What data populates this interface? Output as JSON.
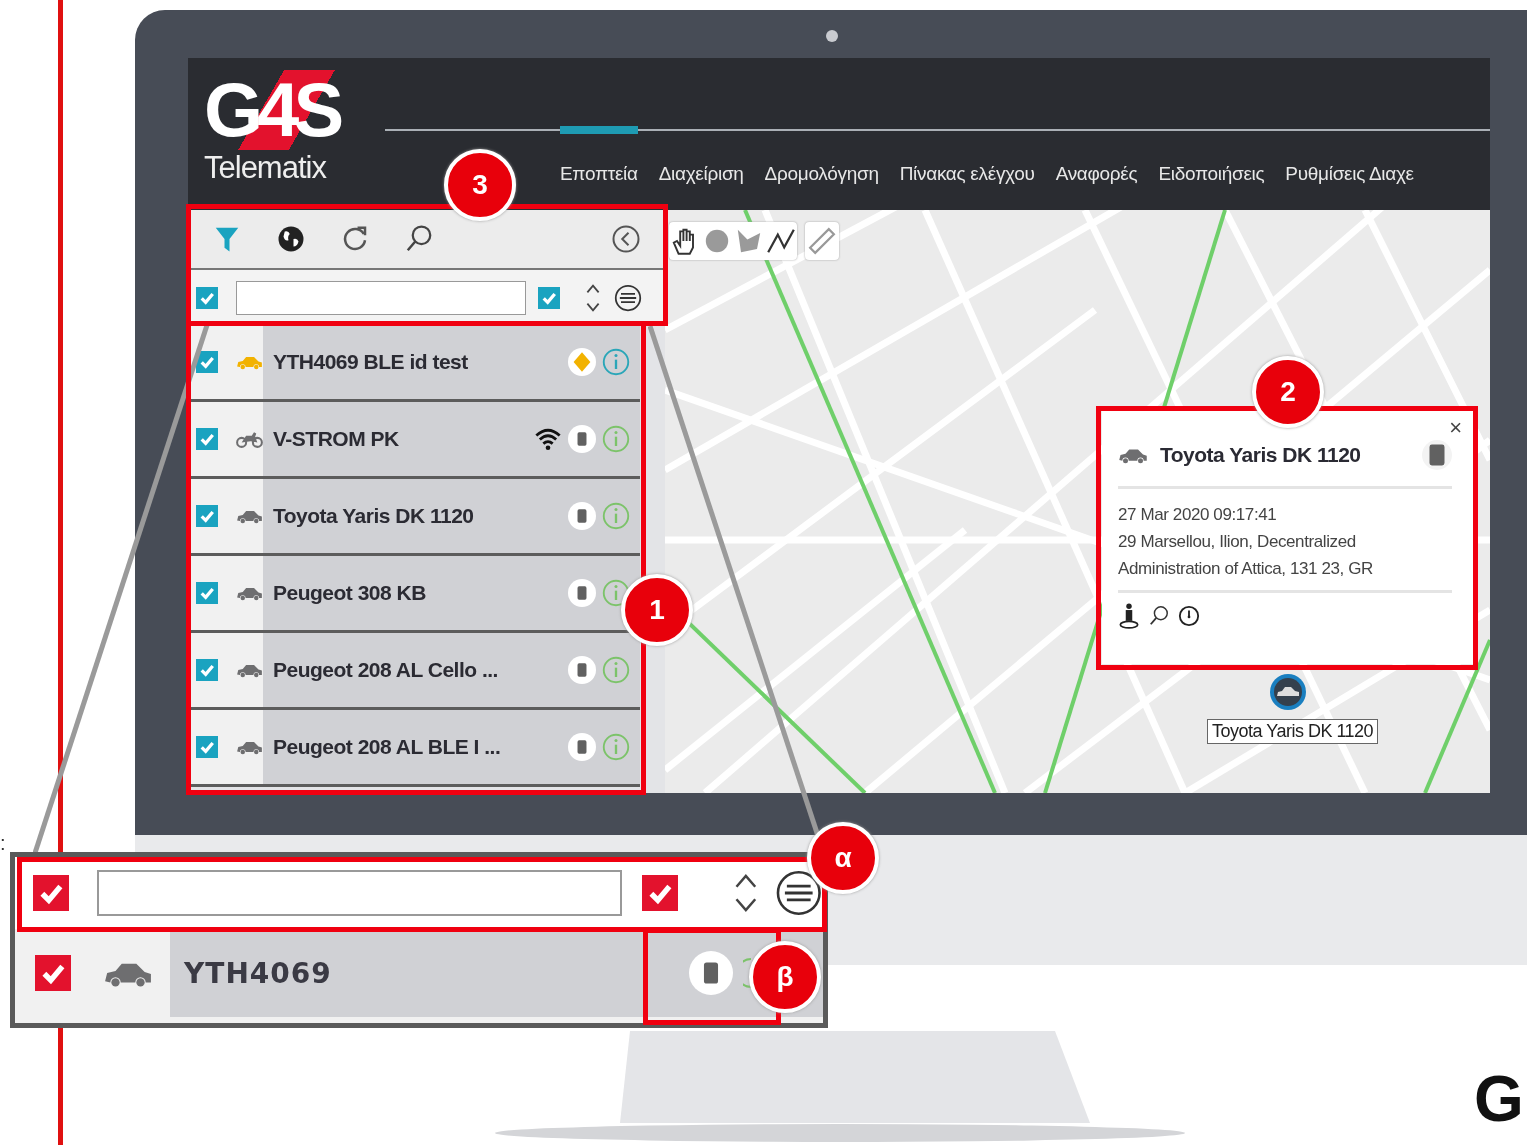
{
  "slide": {
    "edge_text": ":",
    "corner_logo": "G"
  },
  "header": {
    "logo": "G4S",
    "product": "Telematix",
    "tabs": [
      {
        "label": "Εποπτεία",
        "selected": true
      },
      {
        "label": "Διαχείριση",
        "selected": false
      },
      {
        "label": "Δρομολόγηση",
        "selected": false
      },
      {
        "label": "Πίνακας ελέγχου",
        "selected": false
      },
      {
        "label": "Αναφορές",
        "selected": false
      },
      {
        "label": "Ειδοποιήσεις",
        "selected": false
      },
      {
        "label": "Ρυθμίσεις Διαχε",
        "selected": false
      }
    ]
  },
  "filter": {
    "select_all_checked": true,
    "option_checked": true
  },
  "vehicles": [
    {
      "name": "YTH4069 BLE id test",
      "kind": "car",
      "color": "#f2b200",
      "checked": true,
      "warning": true,
      "signal": false
    },
    {
      "name": "V-STROM PK",
      "kind": "motorbike",
      "color": "#6e6e70",
      "checked": true,
      "warning": false,
      "signal": true
    },
    {
      "name": "Toyota Yaris DK 1120",
      "kind": "car",
      "color": "#6e6e70",
      "checked": true,
      "warning": false,
      "signal": false
    },
    {
      "name": "Peugeot 308 KB",
      "kind": "car",
      "color": "#6e6e70",
      "checked": true,
      "warning": false,
      "signal": false
    },
    {
      "name": "Peugeot 208 AL Cello ...",
      "kind": "car",
      "color": "#6e6e70",
      "checked": true,
      "warning": false,
      "signal": false
    },
    {
      "name": "Peugeot 208 AL BLE I ...",
      "kind": "car",
      "color": "#6e6e70",
      "checked": true,
      "warning": false,
      "signal": false
    }
  ],
  "popup": {
    "close": "×",
    "title": "Toyota Yaris DK 1120",
    "timestamp": "27 Mar 2020 09:17:41",
    "address": "29 Marsellou, Ilion, Decentralized Administration of Attica, 131 23, GR"
  },
  "map_marker": {
    "label": "Toyota Yaris DK 1120"
  },
  "callouts": [
    "3",
    "2",
    "1",
    "α",
    "β"
  ],
  "inset": {
    "filter": {
      "select_all_checked": true,
      "option_checked": true
    },
    "row": {
      "name": "YTH4069",
      "kind": "car",
      "checked": true,
      "warning": false
    }
  }
}
